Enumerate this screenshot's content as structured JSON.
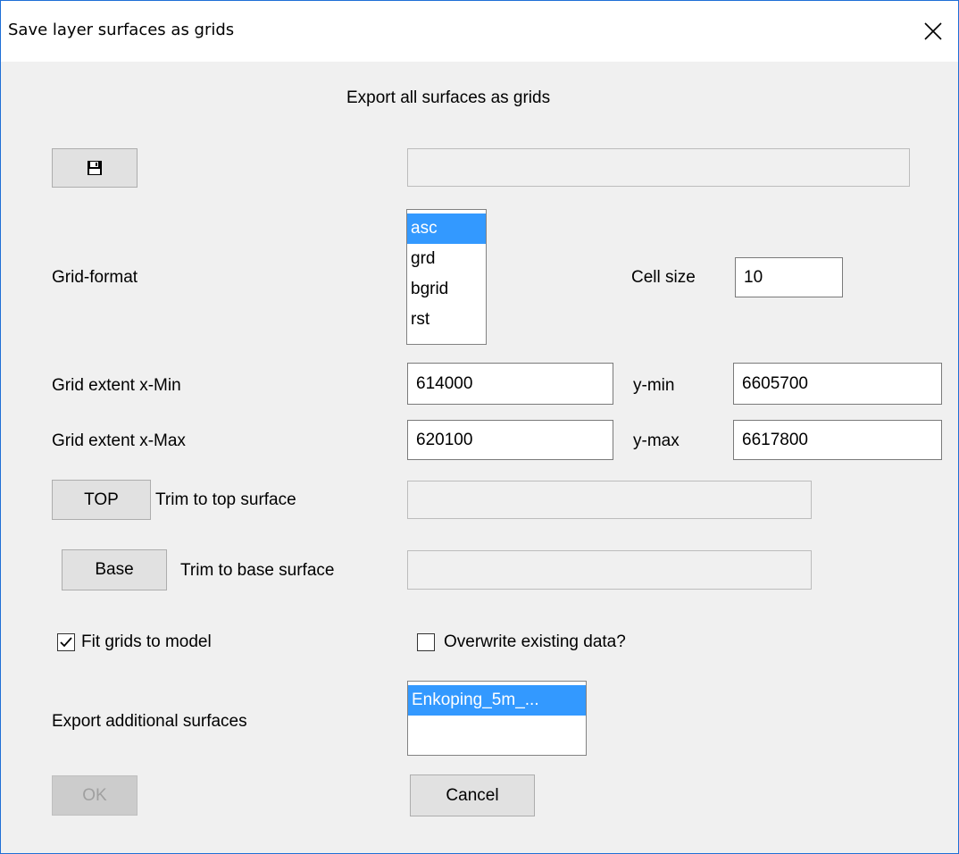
{
  "window": {
    "title": "Save layer surfaces as grids",
    "close_glyph": "✕"
  },
  "heading": "Export all surfaces as grids",
  "save_button": {
    "icon": "floppy-disk-icon"
  },
  "output_path": {
    "value": ""
  },
  "grid_format": {
    "label": "Grid-format",
    "options": [
      "asc",
      "grd",
      "bgrid",
      "rst"
    ],
    "selected": "asc"
  },
  "cell_size": {
    "label": "Cell size",
    "value": "10"
  },
  "extent": {
    "xmin_label": "Grid extent x-Min",
    "xmin": "614000",
    "ymin_label": "y-min",
    "ymin": "6605700",
    "xmax_label": "Grid extent x-Max",
    "xmax": "620100",
    "ymax_label": "y-max",
    "ymax": "6617800"
  },
  "top": {
    "button": "TOP",
    "label": "Trim to top surface",
    "value": ""
  },
  "base": {
    "button": "Base",
    "label": "Trim to base surface",
    "value": ""
  },
  "fit_grids": {
    "label": "Fit grids to model",
    "checked": true
  },
  "overwrite": {
    "label": "Overwrite existing data?",
    "checked": false
  },
  "additional": {
    "label": "Export additional surfaces",
    "items": [
      "Enkoping_5m_..."
    ]
  },
  "buttons": {
    "ok": "OK",
    "cancel": "Cancel"
  },
  "colors": {
    "selection": "#3399ff",
    "window_bg": "#f0f0f0",
    "border_accent": "#1f6fd6"
  }
}
